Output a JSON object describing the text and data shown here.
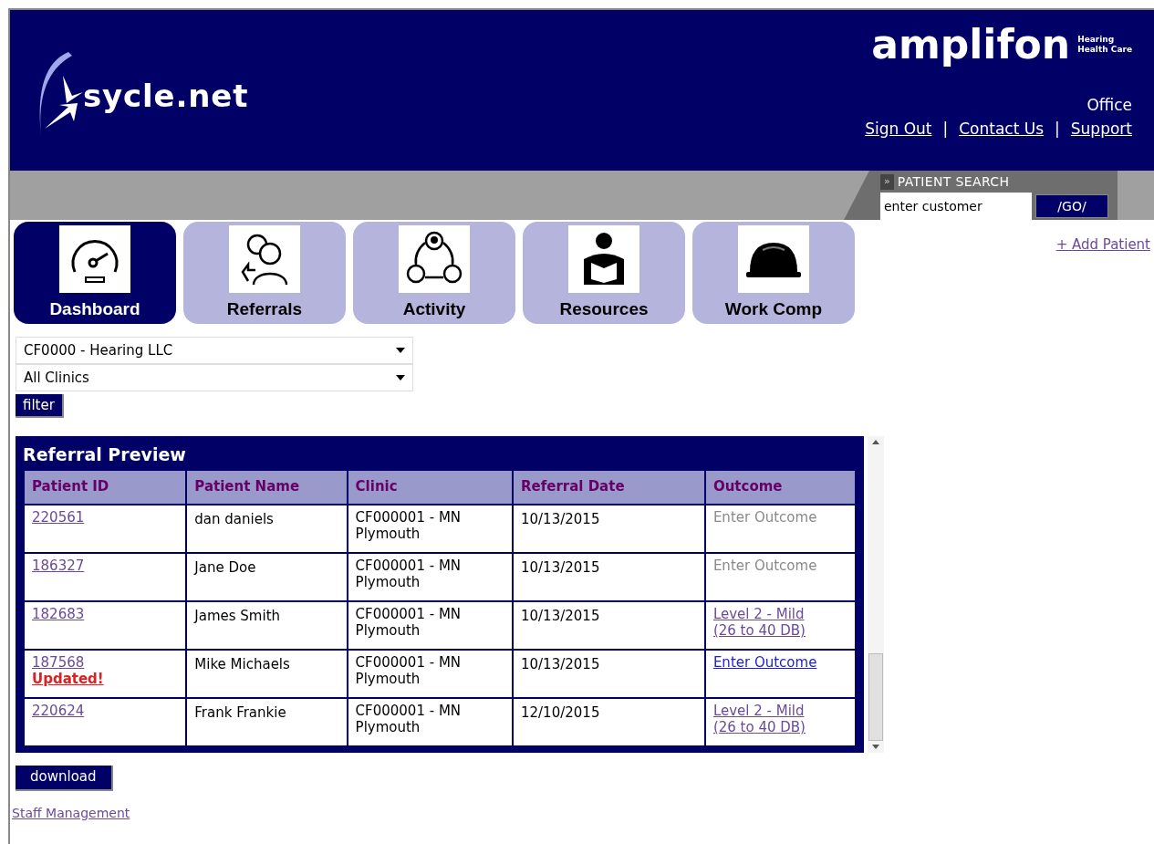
{
  "header": {
    "logo_text": "sycle.net",
    "brand": {
      "name": "amplifon",
      "tagline_1": "Hearing",
      "tagline_2": "Health Care"
    },
    "office": "Office",
    "links": [
      "Sign Out",
      "Contact Us",
      "Support"
    ],
    "separator": "|"
  },
  "patient_search": {
    "label": "PATIENT SEARCH",
    "marker": "»",
    "value": "enter customer",
    "button": "/GO/"
  },
  "add_patient": "+ Add Patient",
  "nav_tabs": [
    {
      "label": "Dashboard",
      "kind": "gauge",
      "selected": true
    },
    {
      "label": "Referrals",
      "kind": "people",
      "selected": false
    },
    {
      "label": "Activity",
      "kind": "cycle",
      "selected": false
    },
    {
      "label": "Resources",
      "kind": "reader",
      "selected": false
    },
    {
      "label": "Work Comp",
      "kind": "hardhat",
      "selected": false
    }
  ],
  "filters": {
    "selects": [
      "CF0000 - Hearing LLC",
      "All Clinics"
    ],
    "button": "filter"
  },
  "table": {
    "title": "Referral Preview",
    "columns": [
      "Patient ID",
      "Patient Name",
      "Clinic",
      "Referral Date",
      "Outcome"
    ],
    "rows": [
      {
        "id": "220561",
        "name": "dan daniels",
        "clinic": "CF000001 - MN Plymouth",
        "date": "10/13/2015",
        "outcome": {
          "text": "Enter Outcome",
          "kind": "pending"
        }
      },
      {
        "id": "186327",
        "name": "Jane Doe",
        "clinic": "CF000001 - MN Plymouth",
        "date": "10/13/2015",
        "outcome": {
          "text": "Enter Outcome",
          "kind": "pending"
        }
      },
      {
        "id": "182683",
        "name": "James Smith",
        "clinic": "CF000001 - MN Plymouth",
        "date": "10/13/2015",
        "outcome": {
          "text": "Level 2 - Mild (26 to 40 DB)",
          "kind": "visited"
        }
      },
      {
        "id": "187568",
        "badge": "Updated!",
        "name": "Mike Michaels",
        "clinic": "CF000001 - MN Plymouth",
        "date": "10/13/2015",
        "outcome": {
          "text": "Enter Outcome",
          "kind": "link"
        }
      },
      {
        "id": "220624",
        "name": "Frank Frankie",
        "clinic": "CF000001 - MN Plymouth",
        "date": "12/10/2015",
        "outcome": {
          "text": "Level 2 - Mild (26 to 40 DB)",
          "kind": "visited"
        }
      }
    ]
  },
  "download": "download",
  "staff_link": "Staff Management"
}
